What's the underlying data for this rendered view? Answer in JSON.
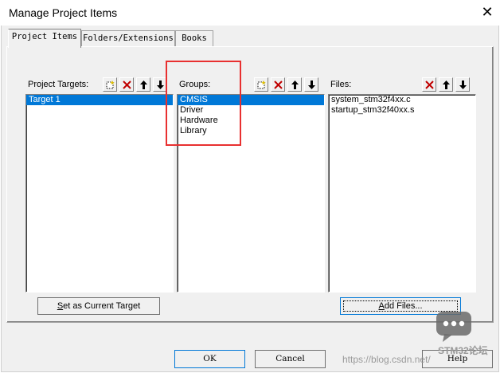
{
  "window": {
    "title": "Manage Project Items"
  },
  "tabs": [
    {
      "label": "Project Items",
      "active": true
    },
    {
      "label": "Folders/Extensions",
      "active": false
    },
    {
      "label": "Books",
      "active": false
    }
  ],
  "targets": {
    "label": "Project Targets:",
    "items": [
      "Target 1"
    ],
    "selected": 0
  },
  "groups": {
    "label": "Groups:",
    "items": [
      "CMSIS",
      "Driver",
      "Hardware",
      "Library"
    ],
    "selected": 0
  },
  "files": {
    "label": "Files:",
    "items": [
      "system_stm32f4xx.c",
      "startup_stm32f40xx.s"
    ]
  },
  "buttons": {
    "set_current_prefix": "S",
    "set_current_rest": "et as Current Target",
    "add_files_prefix": "A",
    "add_files_rest": "dd Files...",
    "ok": "OK",
    "cancel": "Cancel",
    "help": "Help"
  },
  "icons": {
    "new": "new-item-icon",
    "delete": "delete-icon",
    "up": "move-up-icon",
    "down": "move-down-icon"
  },
  "watermark": {
    "text": "https://blog.csdn.net/",
    "logo_text": "STM32论坛"
  },
  "colors": {
    "selection": "#0078d7",
    "highlight_box": "#e83030",
    "delete_red": "#c00000"
  }
}
